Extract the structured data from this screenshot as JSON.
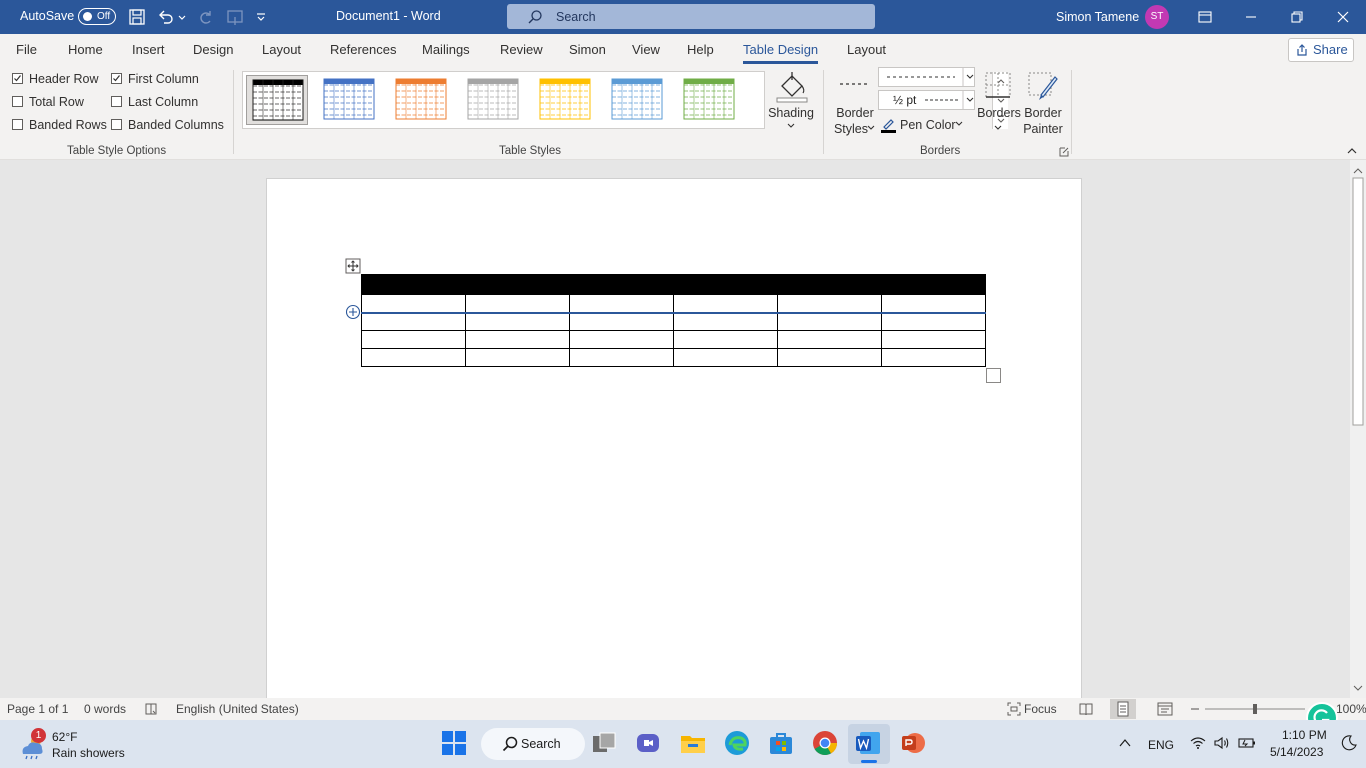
{
  "titlebar": {
    "autosave_label": "AutoSave",
    "autosave_state": "Off",
    "doc_title": "Document1  -  Word",
    "search_placeholder": "Search",
    "user_name": "Simon Tamene",
    "user_initials": "ST"
  },
  "tabs": [
    "File",
    "Home",
    "Insert",
    "Design",
    "Layout",
    "References",
    "Mailings",
    "Review",
    "Simon",
    "View",
    "Help",
    "Table Design",
    "Layout"
  ],
  "active_tab": "Table Design",
  "share_label": "Share",
  "ribbon": {
    "table_style_options": {
      "group_label": "Table Style Options",
      "options": [
        {
          "label": "Header Row",
          "checked": true
        },
        {
          "label": "First Column",
          "checked": true
        },
        {
          "label": "Total Row",
          "checked": false
        },
        {
          "label": "Last Column",
          "checked": false
        },
        {
          "label": "Banded Rows",
          "checked": false
        },
        {
          "label": "Banded Columns",
          "checked": false
        }
      ]
    },
    "table_styles": {
      "group_label": "Table Styles",
      "style_colors": [
        "#000000",
        "#4472c4",
        "#ed7d31",
        "#a5a5a5",
        "#ffc000",
        "#5b9bd5",
        "#70ad47"
      ],
      "shading_label": "Shading"
    },
    "borders": {
      "group_label": "Borders",
      "border_styles_label_1": "Border",
      "border_styles_label_2": "Styles",
      "line_weight": "½ pt",
      "pen_color_label": "Pen Color",
      "borders_label": "Borders",
      "border_painter_label_1": "Border",
      "border_painter_label_2": "Painter"
    }
  },
  "document": {
    "table": {
      "rows": 5,
      "columns": 6,
      "header_row": true
    }
  },
  "statusbar": {
    "page": "Page 1 of 1",
    "words": "0 words",
    "language": "English (United States)",
    "focus": "Focus",
    "zoom": "100%"
  },
  "taskbar": {
    "weather_temp": "62°F",
    "weather_desc": "Rain showers",
    "weather_badge": "1",
    "search_label": "Search",
    "lang": "ENG",
    "time": "1:10 PM",
    "date": "5/14/2023"
  }
}
